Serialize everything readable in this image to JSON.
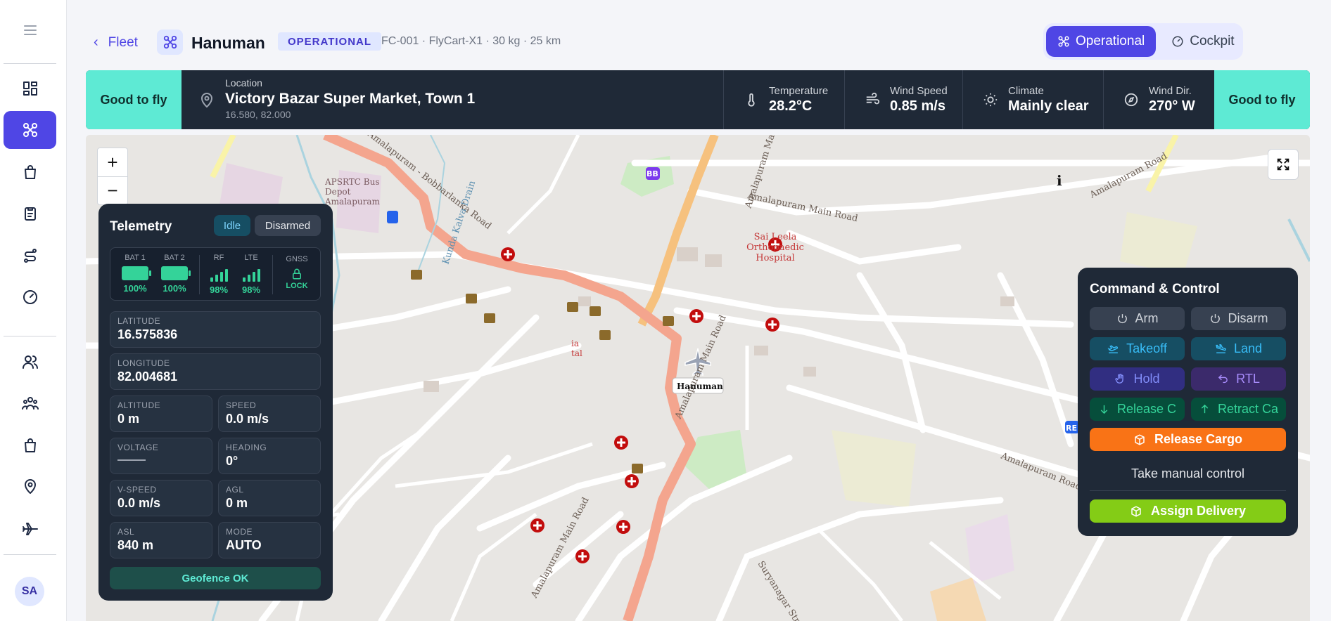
{
  "header": {
    "back_label": "Fleet",
    "drone_name": "Hanuman",
    "status_badge": "OPERATIONAL",
    "meta": "FC-001 · FlyCart-X1 · 30 kg · 25 km",
    "modes": [
      "Operational",
      "Cockpit"
    ],
    "active_mode": "Operational"
  },
  "status_bar": {
    "left_status": "Good to fly",
    "right_status": "Good to fly",
    "location_label": "Location",
    "location_name": "Victory Bazar Super Market, Town 1",
    "location_coords": "16.580, 82.000",
    "weather": [
      {
        "label": "Temperature",
        "value": "28.2°C",
        "icon": "thermometer-icon"
      },
      {
        "label": "Wind Speed",
        "value": "0.85 m/s",
        "icon": "wind-icon"
      },
      {
        "label": "Climate",
        "value": "Mainly clear",
        "icon": "sun-icon"
      },
      {
        "label": "Wind Dir.",
        "value": "270° W",
        "icon": "compass-icon"
      }
    ]
  },
  "map": {
    "zoom_in": "+",
    "zoom_out": "−",
    "labels": {
      "road_bobbarlanka": "Amalapuram - Bobbarlanka Road",
      "road_main_1": "Amalapuram Main Road",
      "road_main_2": "Amalapuram Main Road",
      "road_main_3": "Amalapuram Main Road",
      "road_main_4": "Amalapuram Main Road",
      "road_top_right": "Amalapuram Road",
      "road_right": "Amalapuram Road",
      "road_suryanagar": "Suryanagar Street",
      "kunda_drain": "Kunda Kalva Drain",
      "bus_depot": "APSRTC Bus Depot Amalapuram",
      "hospital": "Sai Leela Orthopaedic Hospital",
      "hospital_partial": "ia tal",
      "bb_marker": "BB",
      "re_marker": "RE",
      "drone_label": "Hanuman",
      "info_marker": "i"
    }
  },
  "telemetry": {
    "title": "Telemetry",
    "state_badge": "Idle",
    "arm_badge": "Disarmed",
    "signals": [
      {
        "label": "BAT 1",
        "value": "100%",
        "type": "battery"
      },
      {
        "label": "BAT 2",
        "value": "100%",
        "type": "battery"
      },
      {
        "label": "RF",
        "value": "98%",
        "type": "signal"
      },
      {
        "label": "LTE",
        "value": "98%",
        "type": "signal"
      },
      {
        "label": "GNSS",
        "value": "LOCK",
        "type": "lock"
      }
    ],
    "latitude_label": "LATITUDE",
    "latitude": "16.575836",
    "longitude_label": "LONGITUDE",
    "longitude": "82.004681",
    "grid": [
      {
        "label": "ALTITUDE",
        "value": "0 m"
      },
      {
        "label": "SPEED",
        "value": "0.0 m/s"
      },
      {
        "label": "VOLTAGE",
        "value": ""
      },
      {
        "label": "HEADING",
        "value": "0°"
      },
      {
        "label": "V-SPEED",
        "value": "0.0 m/s"
      },
      {
        "label": "AGL",
        "value": "0 m"
      },
      {
        "label": "ASL",
        "value": "840 m"
      },
      {
        "label": "MODE",
        "value": "AUTO"
      }
    ],
    "geofence": "Geofence OK"
  },
  "command": {
    "title": "Command & Control",
    "buttons": [
      "Arm",
      "Disarm",
      "Takeoff",
      "Land",
      "Hold",
      "RTL",
      "Release C",
      "Retract Ca"
    ],
    "release_cargo": "Release Cargo",
    "manual": "Take manual control",
    "assign": "Assign Delivery"
  },
  "user": {
    "initials": "SA"
  },
  "colors": {
    "accent": "#4f46e5",
    "good": "#5eead4",
    "panel": "#1f2937",
    "route": "#f4a58e"
  }
}
